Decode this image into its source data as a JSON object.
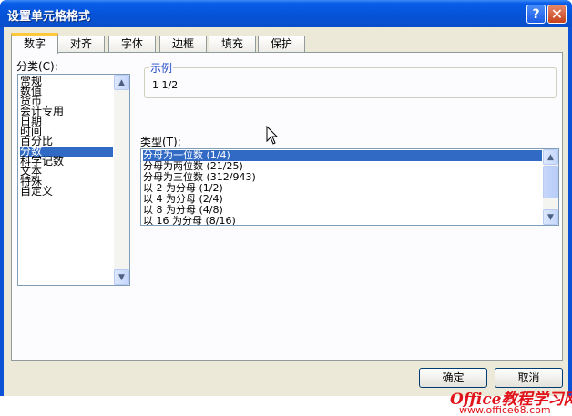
{
  "window": {
    "title": "设置单元格格式"
  },
  "titlebar_buttons": {
    "help": "?",
    "close": "✕"
  },
  "tabs": [
    {
      "label": "数字"
    },
    {
      "label": "对齐"
    },
    {
      "label": "字体"
    },
    {
      "label": "边框"
    },
    {
      "label": "填充"
    },
    {
      "label": "保护"
    }
  ],
  "category": {
    "label": "分类(C):",
    "items": [
      "常规",
      "数值",
      "货币",
      "会计专用",
      "日期",
      "时间",
      "百分比",
      "分数",
      "科学记数",
      "文本",
      "特殊",
      "自定义"
    ],
    "selected": "分数"
  },
  "sample": {
    "title": "示例",
    "value": "1 1/2"
  },
  "type": {
    "label": "类型(T):",
    "items": [
      "分母为一位数 (1/4)",
      "分母为两位数 (21/25)",
      "分母为三位数 (312/943)",
      "以 2 为分母 (1/2)",
      "以 4 为分母 (2/4)",
      "以 8 为分母 (4/8)",
      "以 16 为分母 (8/16)"
    ],
    "selected": "分母为一位数 (1/4)"
  },
  "buttons": {
    "ok": "确定",
    "cancel": "取消"
  },
  "watermark": {
    "text": "Office教程学习网",
    "url": "www.office68.com"
  },
  "colors": {
    "titlebar": "#0553D8",
    "selection": "#316AC5",
    "tab_highlight": "#FFC83C",
    "watermark": "#E0121A"
  }
}
